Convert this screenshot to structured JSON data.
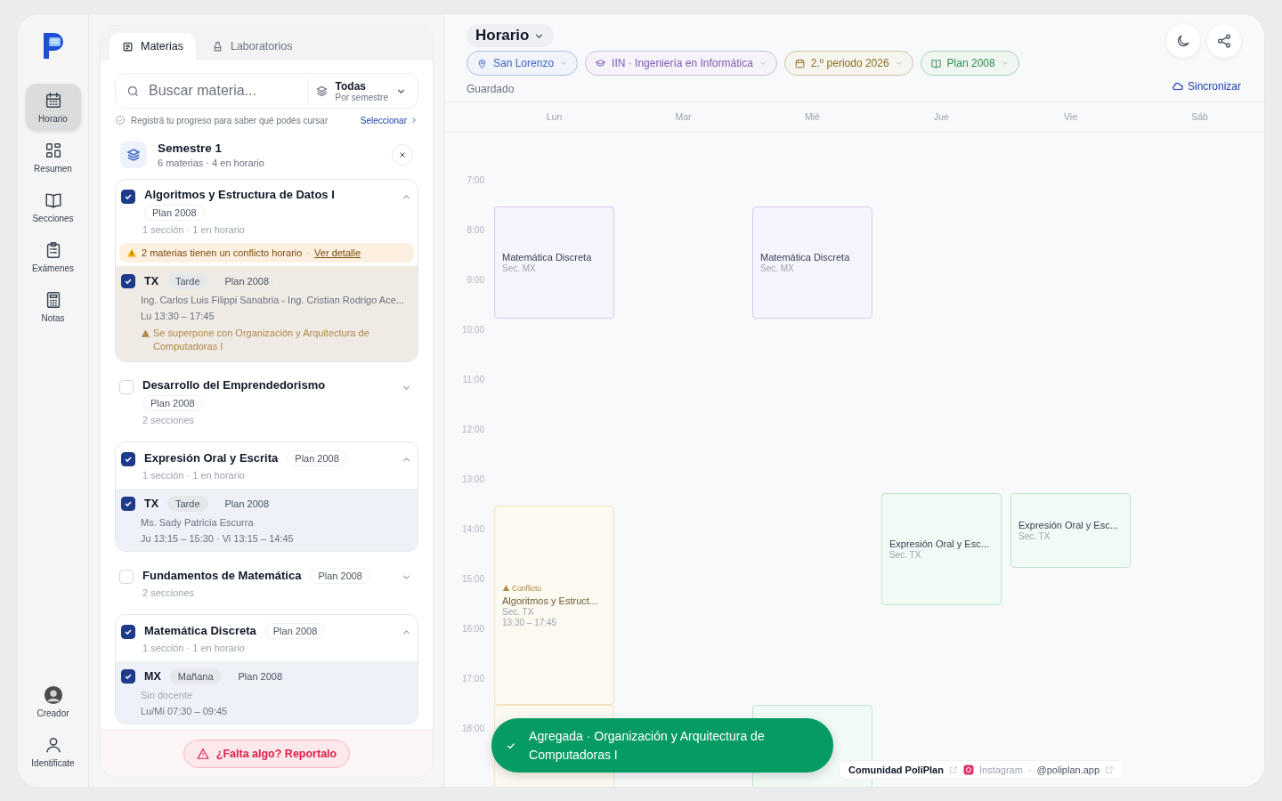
{
  "nav": {
    "items": [
      {
        "label": "Horario",
        "selected": true
      },
      {
        "label": "Resumen",
        "selected": false
      },
      {
        "label": "Secciones",
        "selected": false
      },
      {
        "label": "Exámenes",
        "selected": false
      },
      {
        "label": "Notas",
        "selected": false
      }
    ],
    "bottom": [
      {
        "label": "Creador"
      },
      {
        "label": "Identificate"
      }
    ]
  },
  "panel": {
    "tabs": [
      {
        "label": "Materias",
        "selected": true
      },
      {
        "label": "Laboratorios",
        "selected": false
      }
    ],
    "search": {
      "placeholder": "Buscar materia..."
    },
    "filter": {
      "value": "Todas",
      "caption": "Por semestre"
    },
    "hint": "Registrá tu progreso para saber qué podés cursar",
    "hint_link": "Seleccionar",
    "semester": {
      "title": "Semestre 1",
      "meta": "6 materias · 4 en horario"
    },
    "subjects": [
      {
        "name": "Algoritmos y Estructura de Datos I",
        "plan": "Plan 2008",
        "meta": "1 sección · 1 en horario",
        "checked": true,
        "expanded": true,
        "alert": {
          "text": "2 materias tienen un conflicto horario",
          "separator": "·",
          "link": "Ver detalle"
        },
        "sections": [
          {
            "code": "TX",
            "shift": "Tarde",
            "plan": "Plan 2008",
            "teacher": "Ing. Carlos Luis Filippi Sanabria - Ing. Cristian Rodrigo Ace...",
            "teacher_missing": false,
            "schedule": "Lu 13:30 – 17:45",
            "conflict": "Se superpone con Organización y Arquitectura de Computadoras I",
            "checked": true
          }
        ]
      },
      {
        "name": "Desarrollo del Emprendedorismo",
        "plan": "Plan 2008",
        "meta": "2 secciones",
        "checked": false,
        "expanded": false
      },
      {
        "name": "Expresión Oral y Escrita",
        "plan": "Plan 2008",
        "meta": "1 sección · 1 en horario",
        "checked": true,
        "expanded": true,
        "sections": [
          {
            "code": "TX",
            "shift": "Tarde",
            "plan": "Plan 2008",
            "teacher": "Ms. Sady Patricia Escurra",
            "teacher_missing": false,
            "schedule": "Ju 13:15 – 15:30 · Vi 13:15 – 14:45",
            "checked": true
          }
        ]
      },
      {
        "name": "Fundamentos de Matemática",
        "plan": "Plan 2008",
        "meta": "2 secciones",
        "checked": false,
        "expanded": false
      },
      {
        "name": "Matemática Discreta",
        "plan": "Plan 2008",
        "meta": "1 sección · 1 en horario",
        "checked": true,
        "expanded": true,
        "sections": [
          {
            "code": "MX",
            "shift": "Mañana",
            "plan": "Plan 2008",
            "teacher": "Sin docente",
            "teacher_missing": true,
            "schedule": "Lu/Mi 07:30 – 09:45",
            "checked": true
          }
        ]
      }
    ],
    "report_button": "¿Falta algo? Reportalo"
  },
  "calendar": {
    "view": "Horario",
    "filters": [
      {
        "label": "San Lorenzo",
        "color": "#3d62c4"
      },
      {
        "label": "IIN · Ingeniería en Informática",
        "color": "#7a5bb5"
      },
      {
        "label": "2.º periodo 2026",
        "color": "#8a6d1f"
      },
      {
        "label": "Plan 2008",
        "color": "#2f8a4f"
      }
    ],
    "save_status": "Guardado",
    "sync": "Sincronizar",
    "hours": [
      "7:00",
      "8:00",
      "9:00",
      "10:00",
      "11:00",
      "12:00",
      "13:00",
      "14:00",
      "15:00",
      "16:00",
      "17:00",
      "18:00"
    ],
    "days": [
      {
        "label": "Lun",
        "events": [
          {
            "title": "Matemática Discreta",
            "section": "Sec. MX",
            "color": "#d6cbf5"
          },
          {
            "flag": "Conflicto",
            "title": "Algoritmos y Estruct...",
            "section": "Sec. TX",
            "time": "13:30 – 17:45",
            "color": "#f3e2bd"
          },
          {
            "color": "#f3e2bd"
          }
        ]
      },
      {
        "label": "Mar"
      },
      {
        "label": "Mié",
        "events": [
          {
            "title": "Matemática Discreta",
            "section": "Sec. MX",
            "color": "#d6cbf5"
          },
          {
            "color": "#bfe6cd"
          }
        ]
      },
      {
        "label": "Jue",
        "events": [
          {
            "title": "Expresión Oral y Esc...",
            "section": "Sec. TX",
            "color": "#bfe6cd"
          }
        ]
      },
      {
        "label": "Vie",
        "events": [
          {
            "title": "Expresión Oral y Esc...",
            "section": "Sec. TX",
            "color": "#bfe6cd"
          }
        ]
      },
      {
        "label": "Sáb"
      }
    ]
  },
  "footer": {
    "community": "Comunidad PoliPlan",
    "network": "Instagram",
    "separator": "·",
    "handle": "@poliplan.app"
  },
  "toast": "Agregada · Organización y Arquitectura de Computadoras I"
}
